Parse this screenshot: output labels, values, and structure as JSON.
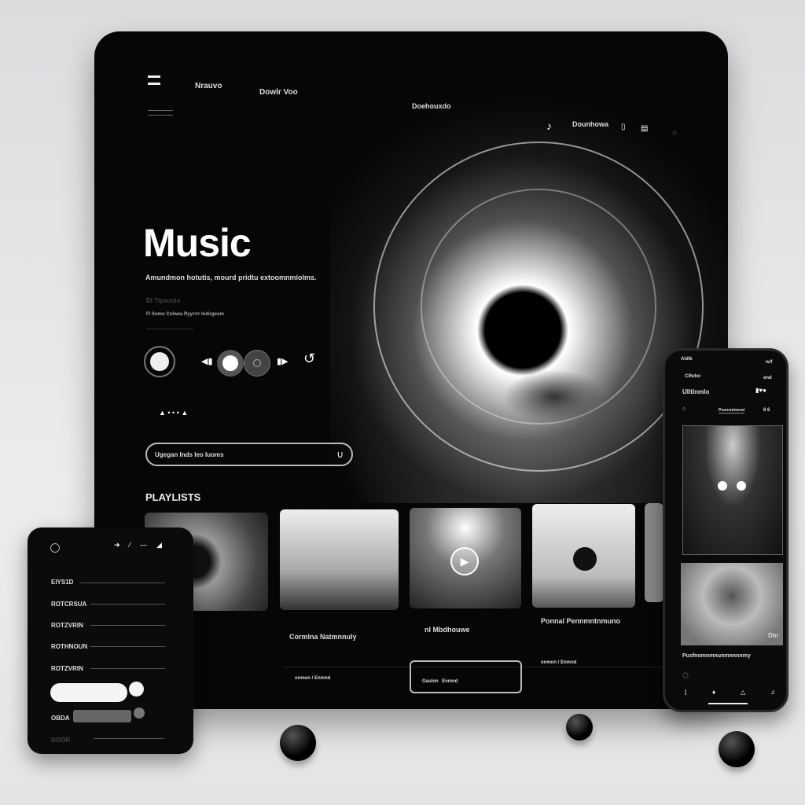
{
  "header": {
    "nav": [
      "Nrauvo",
      "Dowlr Voo",
      "Doehouxdo"
    ],
    "right_label": "Dounhowa",
    "icons": [
      "menu-icon",
      "music-note-icon",
      "bookmark-icon",
      "document-icon",
      "settings-icon"
    ]
  },
  "hero": {
    "title": "Music",
    "subtitle": "Amundmon hotutis, mourd pridtu extoomnmiolms.",
    "meta1": "Dl Tipsoolo",
    "meta2": "Fl Sumo Colwea Ryyrrrr Indirgeum"
  },
  "player": {
    "controls": [
      "record-button",
      "previous-button",
      "play-button",
      "volume-knob",
      "next-button",
      "repeat-button"
    ]
  },
  "search": {
    "placeholder": "Ugegan Inds leo Iuoms"
  },
  "playlists": {
    "heading": "PLAYLISTS",
    "items": [
      {
        "title": "Cormlna Natmnnuly"
      },
      {
        "title": "nl Mbdhouwe"
      },
      {
        "title": "Ponnal Pennmntnmuno"
      }
    ],
    "footer": [
      {
        "a": "onmon",
        "b": "Enmnd"
      },
      {
        "a": "Gaulon",
        "b": "Enmnd"
      },
      {
        "a": "onmon",
        "b": "Enmnd"
      }
    ]
  },
  "panel": {
    "rows": [
      "EIYS1D",
      "ROTCRSUA",
      "ROTZVRIN",
      "ROTHNOUN",
      "ROTZVRIN"
    ],
    "slider_label": "OBDA",
    "last_label": "DOOR",
    "slider1_value": 0.8,
    "slider2_value": 0.75
  },
  "phone": {
    "status_left": "Aldlk",
    "status_right": "wif",
    "top_left": "Clfwbo",
    "top_right": "end",
    "title": "Ulltlnmlo",
    "tab": "Posnxntmend",
    "tab_right": "8 6",
    "badge": "Dln",
    "track": "Pusfnomnmnunmnnnnmy"
  }
}
